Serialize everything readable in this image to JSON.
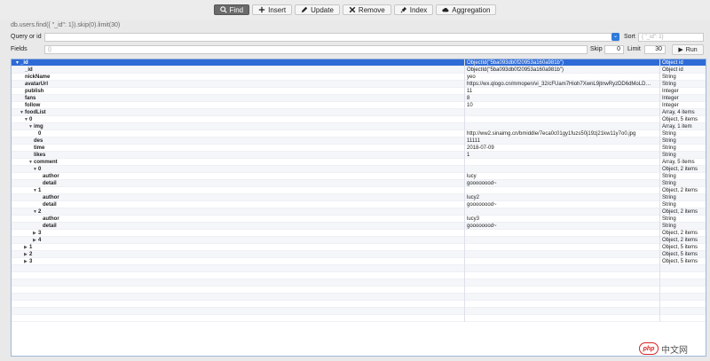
{
  "toolbar": {
    "buttons": [
      {
        "label": "Find",
        "icon": "find-icon",
        "active": true
      },
      {
        "label": "Insert",
        "icon": "plus-icon",
        "active": false
      },
      {
        "label": "Update",
        "icon": "pencil-icon",
        "active": false
      },
      {
        "label": "Remove",
        "icon": "x-icon",
        "active": false
      },
      {
        "label": "Index",
        "icon": "pin-icon",
        "active": false
      },
      {
        "label": "Aggregation",
        "icon": "cloud-icon",
        "active": false
      }
    ]
  },
  "query": {
    "command": "db.users.find({ \"_id\": 1}).skip(0).limit(30)",
    "query_label": "Query or id",
    "query_value": "",
    "sort_label": "Sort",
    "sort_placeholder": "{ \"_id\": 1}",
    "fields_label": "Fields",
    "fields_placeholder": "{}",
    "skip_label": "Skip",
    "skip_value": "0",
    "limit_label": "Limit",
    "limit_value": "30",
    "run_label": "Run"
  },
  "results": [
    {
      "depth": 0,
      "expand": "open",
      "key": "_id",
      "value": "ObjectId(\"5ba093db0f20953a160a981b\")",
      "type": "Object id",
      "selected": true
    },
    {
      "depth": 1,
      "expand": "none",
      "key": "_id",
      "value": "ObjectId(\"5ba093db0f20953a160a981b\")",
      "type": "Object id"
    },
    {
      "depth": 1,
      "expand": "none",
      "key": "nickName",
      "value": "yeo",
      "type": "String"
    },
    {
      "depth": 1,
      "expand": "none",
      "key": "avatarUrl",
      "value": "https://wx.qlogo.cn/mmopen/vi_32/cFUam7Hioh7XwnL9jtnwRyzDD6dMoLD…",
      "type": "String"
    },
    {
      "depth": 1,
      "expand": "none",
      "key": "publish",
      "value": "11",
      "type": "Integer"
    },
    {
      "depth": 1,
      "expand": "none",
      "key": "fans",
      "value": "8",
      "type": "Integer"
    },
    {
      "depth": 1,
      "expand": "none",
      "key": "follow",
      "value": "10",
      "type": "Integer"
    },
    {
      "depth": 1,
      "expand": "open",
      "key": "foodList",
      "value": "",
      "type": "Array, 4 items"
    },
    {
      "depth": 2,
      "expand": "open",
      "key": "0",
      "value": "",
      "type": "Object, 5 items"
    },
    {
      "depth": 3,
      "expand": "open",
      "key": "img",
      "value": "",
      "type": "Array, 1 item"
    },
    {
      "depth": 4,
      "expand": "none",
      "key": "0",
      "value": "http://ww2.sinaimg.cn/bmiddle/7eca0c01gy1fuzs50j19zj21kw11y7o0.jpg",
      "type": "String"
    },
    {
      "depth": 3,
      "expand": "none",
      "key": "des",
      "value": "11111",
      "type": "String"
    },
    {
      "depth": 3,
      "expand": "none",
      "key": "time",
      "value": "2018-07-09",
      "type": "String"
    },
    {
      "depth": 3,
      "expand": "none",
      "key": "likes",
      "value": "1",
      "type": "String"
    },
    {
      "depth": 3,
      "expand": "open",
      "key": "comment",
      "value": "",
      "type": "Array, 5 items"
    },
    {
      "depth": 4,
      "expand": "open",
      "key": "0",
      "value": "",
      "type": "Object, 2 items"
    },
    {
      "depth": 5,
      "expand": "none",
      "key": "author",
      "value": "lucy",
      "type": "String"
    },
    {
      "depth": 5,
      "expand": "none",
      "key": "detail",
      "value": "goooooood~",
      "type": "String"
    },
    {
      "depth": 4,
      "expand": "open",
      "key": "1",
      "value": "",
      "type": "Object, 2 items"
    },
    {
      "depth": 5,
      "expand": "none",
      "key": "author",
      "value": "lucy2",
      "type": "String"
    },
    {
      "depth": 5,
      "expand": "none",
      "key": "detail",
      "value": "goooooood~",
      "type": "String"
    },
    {
      "depth": 4,
      "expand": "open",
      "key": "2",
      "value": "",
      "type": "Object, 2 items"
    },
    {
      "depth": 5,
      "expand": "none",
      "key": "author",
      "value": "lucy3",
      "type": "String"
    },
    {
      "depth": 5,
      "expand": "none",
      "key": "detail",
      "value": "goooooood~",
      "type": "String"
    },
    {
      "depth": 4,
      "expand": "closed",
      "key": "3",
      "value": "",
      "type": "Object, 2 items"
    },
    {
      "depth": 4,
      "expand": "closed",
      "key": "4",
      "value": "",
      "type": "Object, 2 items"
    },
    {
      "depth": 2,
      "expand": "closed",
      "key": "1",
      "value": "",
      "type": "Object, 5 items"
    },
    {
      "depth": 2,
      "expand": "closed",
      "key": "2",
      "value": "",
      "type": "Object, 5 items"
    },
    {
      "depth": 2,
      "expand": "closed",
      "key": "3",
      "value": "",
      "type": "Object, 5 items"
    }
  ],
  "watermark": {
    "text": "中文网",
    "logo_text": "php"
  }
}
